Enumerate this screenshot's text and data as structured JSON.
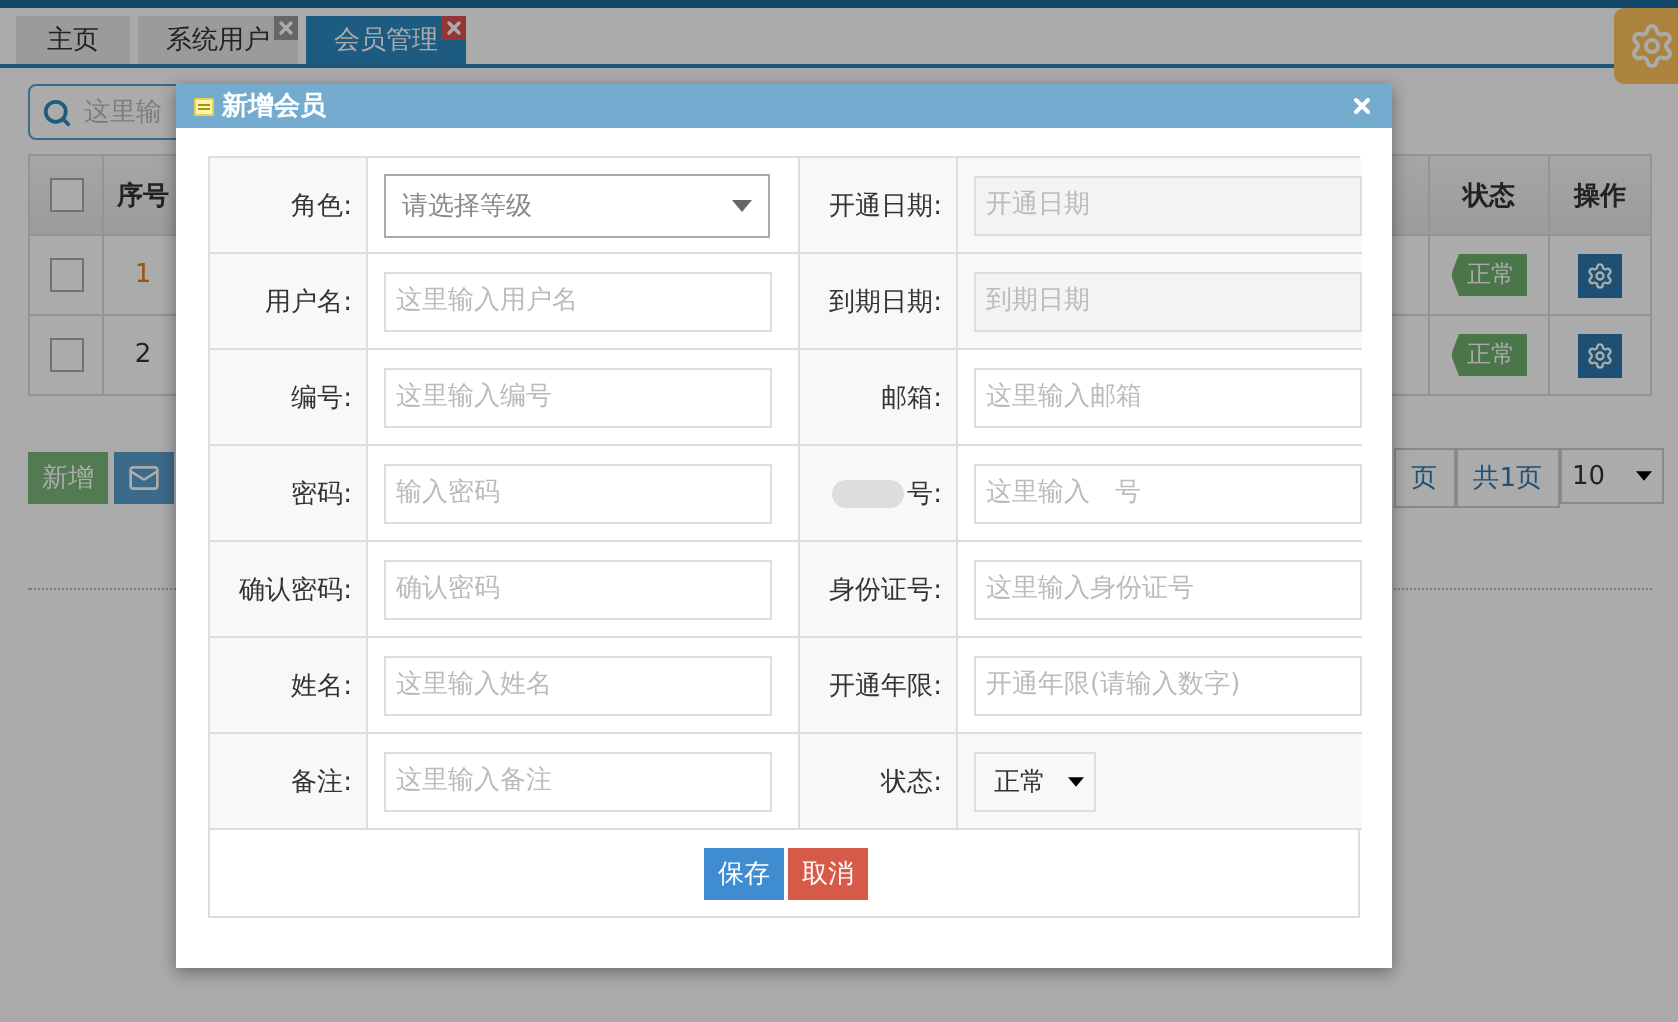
{
  "tabs": [
    {
      "label": "主页",
      "selected": false,
      "closable": false
    },
    {
      "label": "系统用户",
      "selected": false,
      "closable": true
    },
    {
      "label": "会员管理",
      "selected": true,
      "closable": true
    }
  ],
  "search": {
    "placeholder": "这里输"
  },
  "table": {
    "header_checked": false,
    "columns": [
      "序号",
      "状态",
      "操作"
    ],
    "rows": [
      {
        "index": "1",
        "highlighted": true,
        "checked": false,
        "status": "正常"
      },
      {
        "index": "2",
        "highlighted": false,
        "checked": false,
        "status": "正常"
      }
    ]
  },
  "actions": [
    "新增"
  ],
  "pagination": {
    "page_fragment": "页",
    "total": "共1页",
    "page_size": "10"
  },
  "dialog": {
    "title": "新增会员",
    "fields": [
      {
        "kind": "select",
        "label": "角色:",
        "placeholder": "请选择等级"
      },
      {
        "kind": "readonly",
        "label": "开通日期:",
        "placeholder": "开通日期"
      },
      {
        "kind": "input",
        "label": "用户名:",
        "placeholder": "这里输入用户名"
      },
      {
        "kind": "readonly",
        "label": "到期日期:",
        "placeholder": "到期日期"
      },
      {
        "kind": "input",
        "label": "编号:",
        "placeholder": "这里输入编号"
      },
      {
        "kind": "input",
        "label": "邮箱:",
        "placeholder": "这里输入邮箱"
      },
      {
        "kind": "input",
        "label": "密码:",
        "placeholder": "输入密码"
      },
      {
        "kind": "input",
        "label": "号:",
        "placeholder": "这里输入   号",
        "redacted": true
      },
      {
        "kind": "input",
        "label": "确认密码:",
        "placeholder": "确认密码"
      },
      {
        "kind": "input",
        "label": "身份证号:",
        "placeholder": "这里输入身份证号"
      },
      {
        "kind": "input",
        "label": "姓名:",
        "placeholder": "这里输入姓名"
      },
      {
        "kind": "input",
        "label": "开通年限:",
        "placeholder": "开通年限(请输入数字)"
      },
      {
        "kind": "input",
        "label": "备注:",
        "placeholder": "这里输入备注"
      },
      {
        "kind": "compact-select",
        "label": "状态:",
        "value": "正常"
      }
    ],
    "buttons": [
      {
        "kind": "primary",
        "label": "保存"
      },
      {
        "kind": "danger",
        "label": "取消"
      }
    ]
  }
}
